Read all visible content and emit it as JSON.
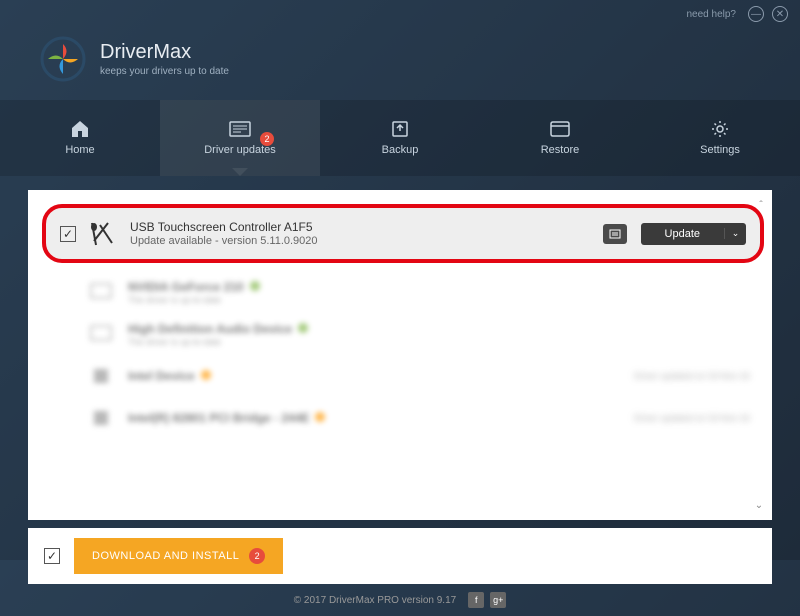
{
  "titlebar": {
    "help": "need help?"
  },
  "brand": {
    "name": "DriverMax",
    "tagline": "keeps your drivers up to date"
  },
  "nav": {
    "home": "Home",
    "updates": "Driver updates",
    "updates_badge": "2",
    "backup": "Backup",
    "restore": "Restore",
    "settings": "Settings"
  },
  "driver": {
    "name": "USB Touchscreen Controller A1F5",
    "sub": "Update available - version 5.11.0.9020",
    "update_label": "Update"
  },
  "blurred": [
    {
      "name": "NVIDIA GeForce 210",
      "sub": "The driver is up-to-date",
      "dot": "green",
      "status": ""
    },
    {
      "name": "High Definition Audio Device",
      "sub": "The driver is up-to-date",
      "dot": "green",
      "status": ""
    },
    {
      "name": "Intel Device",
      "sub": "",
      "dot": "orange",
      "status": "Driver updated on 03-Nov-16"
    },
    {
      "name": "Intel(R) 82801 PCI Bridge - 244E",
      "sub": "",
      "dot": "orange",
      "status": "Driver updated on 03-Nov-16"
    }
  ],
  "download": {
    "label": "DOWNLOAD AND INSTALL",
    "badge": "2"
  },
  "footer": {
    "copyright": "© 2017 DriverMax PRO version 9.17"
  }
}
